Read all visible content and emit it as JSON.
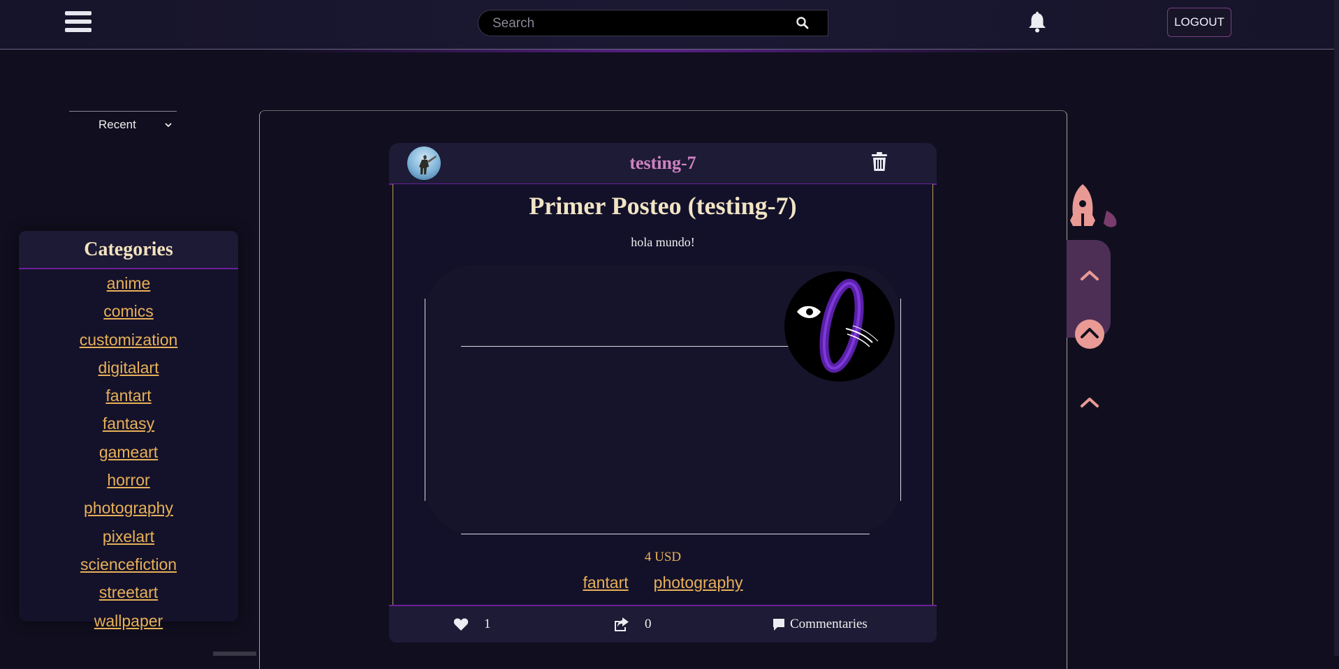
{
  "header": {
    "search_placeholder": "Search",
    "logout_label": "LOGOUT"
  },
  "sort": {
    "selected": "Recent"
  },
  "categories": {
    "title": "Categories",
    "items": [
      "anime",
      "comics",
      "customization",
      "digitalart",
      "fantart",
      "fantasy",
      "gameart",
      "horror",
      "photography",
      "pixelart",
      "sciencefiction",
      "streetart",
      "wallpaper"
    ]
  },
  "post": {
    "username": "testing-7",
    "title": "Primer Posteo (testing-7)",
    "description": "hola mundo!",
    "price": "4 USD",
    "tags": [
      "fantart",
      "photography"
    ],
    "likes": "1",
    "shares": "0",
    "comments_label": "Commentaries"
  },
  "colors": {
    "background": "#110f1f",
    "accent_gold": "#e8b058",
    "accent_pink": "#e99a95",
    "accent_purple": "#6b1f9a",
    "username": "#d082c2"
  },
  "icons": [
    "menu-icon",
    "search-icon",
    "bell-icon",
    "chevron-down-icon",
    "trash-icon",
    "heart-icon",
    "share-icon",
    "comment-icon",
    "rocket-icon",
    "chevron-up-icon"
  ]
}
